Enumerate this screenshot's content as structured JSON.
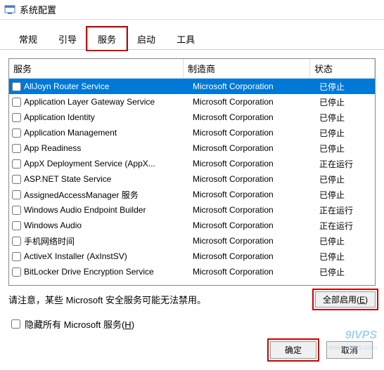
{
  "window": {
    "title": "系统配置"
  },
  "tabs": [
    {
      "id": "general",
      "label": "常规"
    },
    {
      "id": "boot",
      "label": "引导"
    },
    {
      "id": "services",
      "label": "服务",
      "active": true,
      "highlighted": true
    },
    {
      "id": "startup",
      "label": "启动"
    },
    {
      "id": "tools",
      "label": "工具"
    }
  ],
  "columns": {
    "name": "服务",
    "mfr": "制造商",
    "status": "状态"
  },
  "rows": [
    {
      "name": "AllJoyn Router Service",
      "mfr": "Microsoft Corporation",
      "status": "已停止",
      "selected": true
    },
    {
      "name": "Application Layer Gateway Service",
      "mfr": "Microsoft Corporation",
      "status": "已停止"
    },
    {
      "name": "Application Identity",
      "mfr": "Microsoft Corporation",
      "status": "已停止"
    },
    {
      "name": "Application Management",
      "mfr": "Microsoft Corporation",
      "status": "已停止"
    },
    {
      "name": "App Readiness",
      "mfr": "Microsoft Corporation",
      "status": "已停止"
    },
    {
      "name": "AppX Deployment Service (AppX...",
      "mfr": "Microsoft Corporation",
      "status": "正在运行"
    },
    {
      "name": "ASP.NET State Service",
      "mfr": "Microsoft Corporation",
      "status": "已停止"
    },
    {
      "name": "AssignedAccessManager 服务",
      "mfr": "Microsoft Corporation",
      "status": "已停止"
    },
    {
      "name": "Windows Audio Endpoint Builder",
      "mfr": "Microsoft Corporation",
      "status": "正在运行"
    },
    {
      "name": "Windows Audio",
      "mfr": "Microsoft Corporation",
      "status": "正在运行"
    },
    {
      "name": "手机网络时间",
      "mfr": "Microsoft Corporation",
      "status": "已停止"
    },
    {
      "name": "ActiveX Installer (AxInstSV)",
      "mfr": "Microsoft Corporation",
      "status": "已停止"
    },
    {
      "name": "BitLocker Drive Encryption Service",
      "mfr": "Microsoft Corporation",
      "status": "已停止"
    }
  ],
  "note": "请注意，某些 Microsoft 安全服务可能无法禁用。",
  "enable_all": {
    "label": "全部启用(",
    "key": "E",
    "suffix": ")"
  },
  "hide_ms": {
    "label": "隐藏所有 Microsoft 服务(",
    "key": "H",
    "suffix": ")"
  },
  "buttons": {
    "ok": "确定",
    "cancel": "取消"
  },
  "watermark": {
    "brand": "9IVPS",
    "url": "www.9ivps.com"
  }
}
